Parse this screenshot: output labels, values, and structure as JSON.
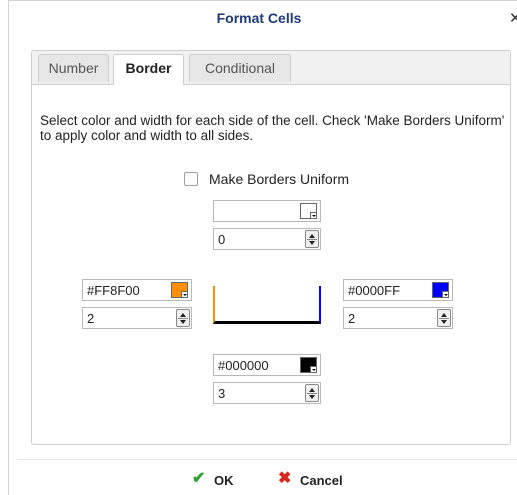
{
  "dialog": {
    "title": "Format Cells",
    "close_icon": "close-icon"
  },
  "tabs": [
    {
      "label": "Number",
      "active": false
    },
    {
      "label": "Border",
      "active": true
    },
    {
      "label": "Conditional",
      "active": false
    }
  ],
  "border": {
    "description": "Select color and width for each side of the cell. Check 'Make Borders Uniform' to apply color and width to all sides.",
    "uniform_label": "Make Borders Uniform",
    "uniform_checked": false,
    "top": {
      "color": "",
      "swatch": "#FFFFFF",
      "width": "0"
    },
    "left": {
      "color": "#FF8F00",
      "swatch": "#FF8F00",
      "width": "2"
    },
    "right": {
      "color": "#0000FF",
      "swatch": "#0000FF",
      "width": "2"
    },
    "bottom": {
      "color": "#000000",
      "swatch": "#000000",
      "width": "3"
    }
  },
  "footer": {
    "ok_label": "OK",
    "cancel_label": "Cancel",
    "ok_icon": "checkmark-icon",
    "cancel_icon": "x-mark-icon",
    "ok_icon_color": "#2e9e2e",
    "cancel_icon_color": "#d9261c"
  }
}
